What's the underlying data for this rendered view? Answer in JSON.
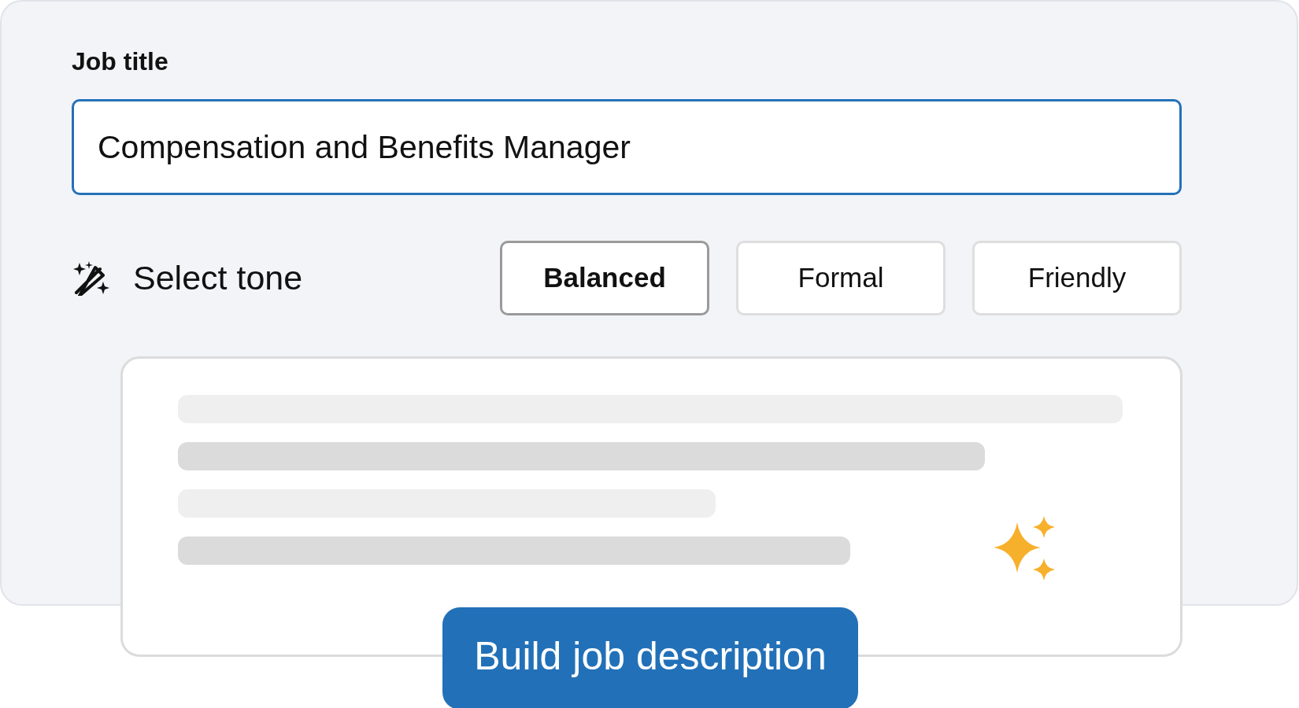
{
  "job_title": {
    "label": "Job title",
    "value": "Compensation and Benefits Manager"
  },
  "tone": {
    "label": "Select tone",
    "options": [
      {
        "label": "Balanced",
        "selected": true
      },
      {
        "label": "Formal",
        "selected": false
      },
      {
        "label": "Friendly",
        "selected": false
      }
    ]
  },
  "build_button": "Build job description"
}
